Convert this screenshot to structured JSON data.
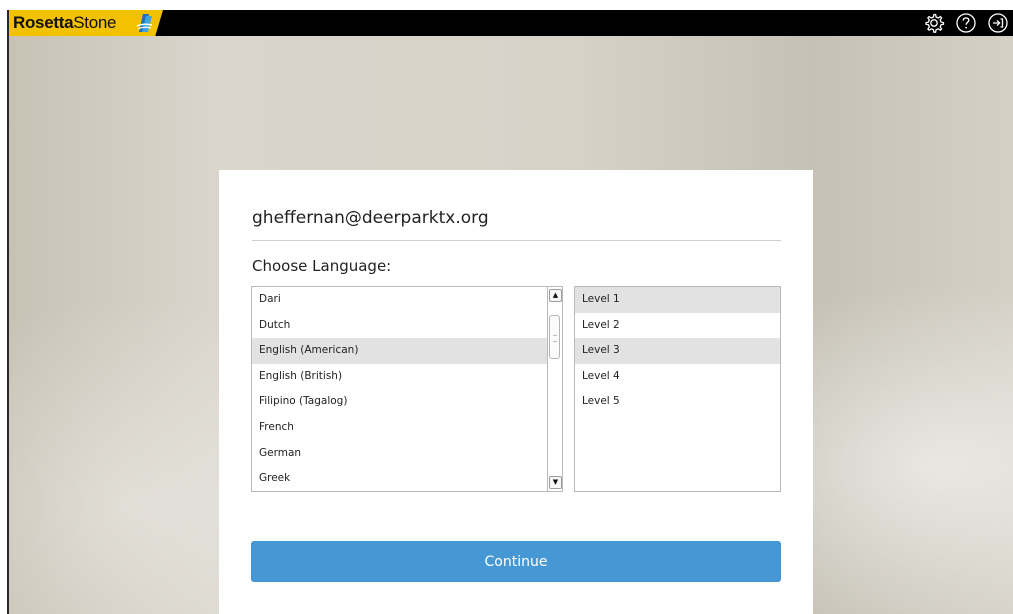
{
  "brand": {
    "name_bold": "Rosetta",
    "name_light": "Stone"
  },
  "toolbar": {
    "icons": [
      "gear-icon",
      "help-icon",
      "signout-icon"
    ]
  },
  "account": {
    "email": "gheffernan@deerparktx.org"
  },
  "language_picker": {
    "label": "Choose Language:",
    "languages": [
      "Dari",
      "Dutch",
      "English (American)",
      "English (British)",
      "Filipino (Tagalog)",
      "French",
      "German",
      "Greek"
    ],
    "selected_language": "English (American)"
  },
  "level_picker": {
    "levels": [
      "Level 1",
      "Level 2",
      "Level 3",
      "Level 4",
      "Level 5"
    ],
    "highlighted": [
      "Level 1",
      "Level 3"
    ]
  },
  "actions": {
    "continue_label": "Continue"
  },
  "colors": {
    "accent": "#4598d4",
    "brand_yellow": "#f2c100",
    "topbar": "#000000"
  }
}
